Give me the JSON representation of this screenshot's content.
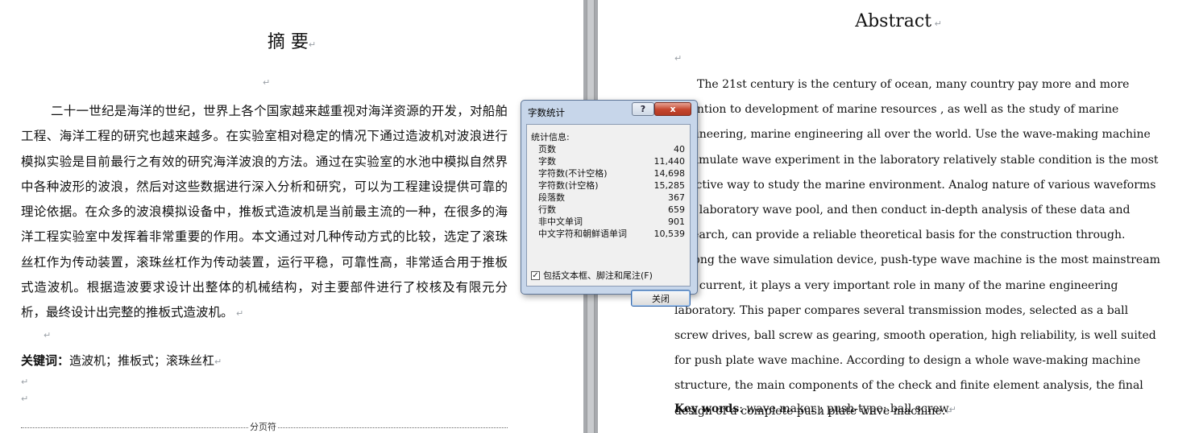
{
  "zh": {
    "title": "摘  要",
    "paragraph": "二十一世纪是海洋的世纪，世界上各个国家越来越重视对海洋资源的开发，对船舶工程、海洋工程的研究也越来越多。在实验室相对稳定的情况下通过造波机对波浪进行模拟实验是目前最行之有效的研究海洋波浪的方法。通过在实验室的水池中模拟自然界中各种波形的波浪，然后对这些数据进行深入分析和研究，可以为工程建设提供可靠的理论依据。在众多的波浪模拟设备中，推板式造波机是当前最主流的一种，在很多的海洋工程实验室中发挥着非常重要的作用。本文通过对几种传动方式的比较，选定了滚珠丝杠作为传动装置，滚珠丝杠作为传动装置，运行平稳，可靠性高，非常适合用于推板式造波机。根据造波要求设计出整体的机械结构，对主要部件进行了校核及有限元分析，最终设计出完整的推板式造波机。",
    "keywords_label": "关键词：",
    "keywords": "造波机；推板式；滚珠丝杠",
    "page_break_label": "分页符"
  },
  "en": {
    "title": "Abstract",
    "paragraph": "The 21st century is the century of ocean, many country pay more and more attention to development of marine resources , as well as the study of marine engineering, marine engineering all over the world. Use the wave-making machine to simulate wave experiment in the laboratory relatively stable condition is the most effective way to study the marine environment. Analog nature of various waveforms in a laboratory wave pool, and then conduct in-depth analysis of these data and research, can provide a reliable theoretical basis for the construction through. Among the wave simulation device, push-type wave machine is the most mainstream of a current, it plays a very important role in many of the marine engineering laboratory. This paper compares several transmission modes, selected as a ball screw drives, ball screw as gearing, smooth operation, high reliability, is well suited for push plate wave machine. According to design a whole wave-making machine structure, the main components of the check and finite element analysis, the final design of a complete push plate wave machine.",
    "keywords_label": "Key words",
    "keywords": ": wave maker ; push-type; ball screw"
  },
  "dialog": {
    "title": "字数统计",
    "help_label": "?",
    "close_x": "x",
    "group_label": "统计信息:",
    "stats": [
      {
        "label": "页数",
        "value": "40"
      },
      {
        "label": "字数",
        "value": "11,440"
      },
      {
        "label": "字符数(不计空格)",
        "value": "14,698"
      },
      {
        "label": "字符数(计空格)",
        "value": "15,285"
      },
      {
        "label": "段落数",
        "value": "367"
      },
      {
        "label": "行数",
        "value": "659"
      },
      {
        "label": "非中文单词",
        "value": "901"
      },
      {
        "label": "中文字符和朝鲜语单词",
        "value": "10,539"
      }
    ],
    "checkbox_label": "包括文本框、脚注和尾注(F)",
    "checkbox_checked": true,
    "close_button": "关闭"
  }
}
